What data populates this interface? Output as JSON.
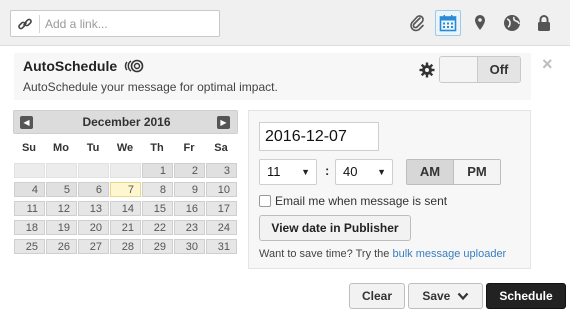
{
  "toolbar": {
    "link_placeholder": "Add a link...",
    "icons": [
      "link-icon",
      "paperclip-icon",
      "calendar-icon",
      "location-pin-icon",
      "globe-icon",
      "lock-icon"
    ],
    "active_icon": "calendar-icon",
    "accent_color": "#2a8ad4"
  },
  "autoschedule": {
    "title": "AutoSchedule",
    "subtitle": "AutoSchedule your message for optimal impact.",
    "toggle_state": "Off",
    "close": "×"
  },
  "calendar": {
    "month_label": "December 2016",
    "weekdays": [
      "Su",
      "Mo",
      "Tu",
      "We",
      "Th",
      "Fr",
      "Sa"
    ],
    "weeks": [
      [
        "",
        "",
        "",
        "",
        "1",
        "2",
        "3"
      ],
      [
        "4",
        "5",
        "6",
        "7",
        "8",
        "9",
        "10"
      ],
      [
        "11",
        "12",
        "13",
        "14",
        "15",
        "16",
        "17"
      ],
      [
        "18",
        "19",
        "20",
        "21",
        "22",
        "23",
        "24"
      ],
      [
        "25",
        "26",
        "27",
        "28",
        "29",
        "30",
        "31"
      ]
    ],
    "selected_day": "7"
  },
  "datetime": {
    "date_value": "2016-12-07",
    "hour": "11",
    "minute": "40",
    "colon": ":",
    "am_label": "AM",
    "pm_label": "PM",
    "selected_period": "AM",
    "email_label": "Email me when message is sent",
    "view_button": "View date in Publisher",
    "save_time_text": "Want to save time? Try the",
    "save_time_link": "bulk message uploader"
  },
  "buttons": {
    "clear": "Clear",
    "save": "Save",
    "schedule": "Schedule"
  }
}
